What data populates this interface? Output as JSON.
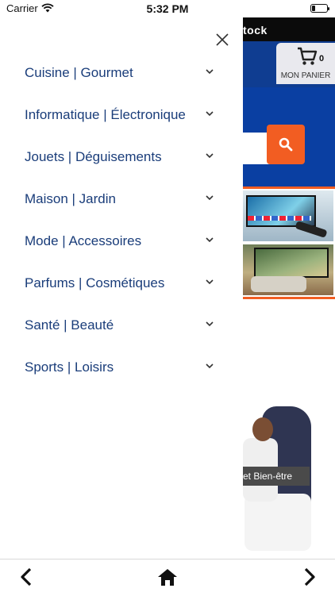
{
  "status_bar": {
    "carrier": "Carrier",
    "time": "5:32 PM"
  },
  "background_page": {
    "topbar_text": "tock",
    "cart": {
      "count": "0",
      "label": "MON PANIER"
    },
    "promo_label": "et Bien-être",
    "colors": {
      "navy": "#0f3d91",
      "accent_orange": "#f25d22",
      "topbar": "#0b0b0b"
    }
  },
  "menu": {
    "close_icon": "close-icon",
    "categories": [
      {
        "label": "Cuisine | Gourmet"
      },
      {
        "label": "Informatique | Électronique"
      },
      {
        "label": "Jouets | Déguisements"
      },
      {
        "label": "Maison | Jardin"
      },
      {
        "label": "Mode | Accessoires"
      },
      {
        "label": "Parfums | Cosmétiques"
      },
      {
        "label": "Santé | Beauté"
      },
      {
        "label": "Sports | Loisirs"
      }
    ],
    "chevron_icon": "chevron-down-icon",
    "text_color": "#1a3d7a"
  },
  "toolbar": {
    "back_icon": "chevron-left-icon",
    "home_icon": "home-icon",
    "forward_icon": "chevron-right-icon"
  }
}
